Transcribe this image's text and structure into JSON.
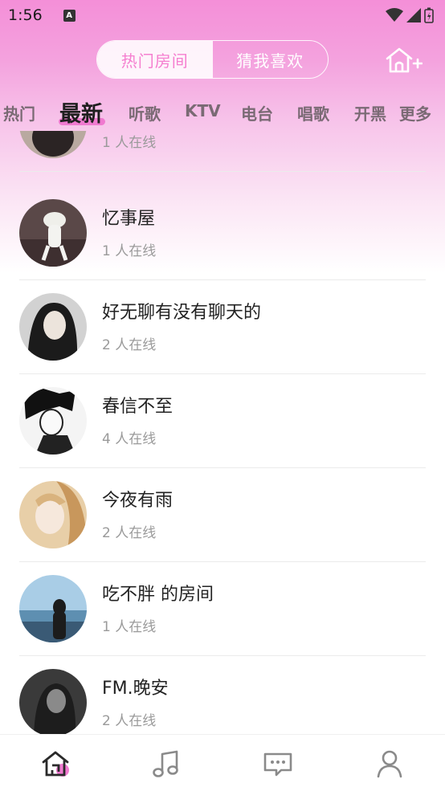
{
  "status_bar": {
    "time": "1:56",
    "notification_badge": "A"
  },
  "top_switch": {
    "tabs": [
      {
        "label": "热门房间",
        "active": true
      },
      {
        "label": "猜我喜欢",
        "active": false
      }
    ]
  },
  "category_tabs": [
    {
      "label": "热门",
      "active": false
    },
    {
      "label": "最新",
      "active": true
    },
    {
      "label": "听歌",
      "active": false
    },
    {
      "label": "KTV",
      "active": false
    },
    {
      "label": "电台",
      "active": false
    },
    {
      "label": "唱歌",
      "active": false
    },
    {
      "label": "开黑",
      "active": false
    },
    {
      "label": "更多",
      "active": false
    }
  ],
  "rooms": [
    {
      "title": "",
      "online": "1 人在线"
    },
    {
      "title": "忆事屋",
      "online": "1 人在线"
    },
    {
      "title": "好无聊有没有聊天的",
      "online": "2 人在线"
    },
    {
      "title": "春信不至",
      "online": "4 人在线"
    },
    {
      "title": "今夜有雨",
      "online": "2 人在线"
    },
    {
      "title": "吃不胖 的房间",
      "online": "1 人在线"
    },
    {
      "title": "FM.晚安",
      "online": "2 人在线"
    }
  ],
  "colors": {
    "accent": "#f07ad0",
    "gradient_top": "#f48fd8"
  },
  "bottom_nav": [
    {
      "icon": "home-icon",
      "active": true
    },
    {
      "icon": "music-note-icon",
      "active": false
    },
    {
      "icon": "chat-icon",
      "active": false
    },
    {
      "icon": "profile-icon",
      "active": false
    }
  ]
}
